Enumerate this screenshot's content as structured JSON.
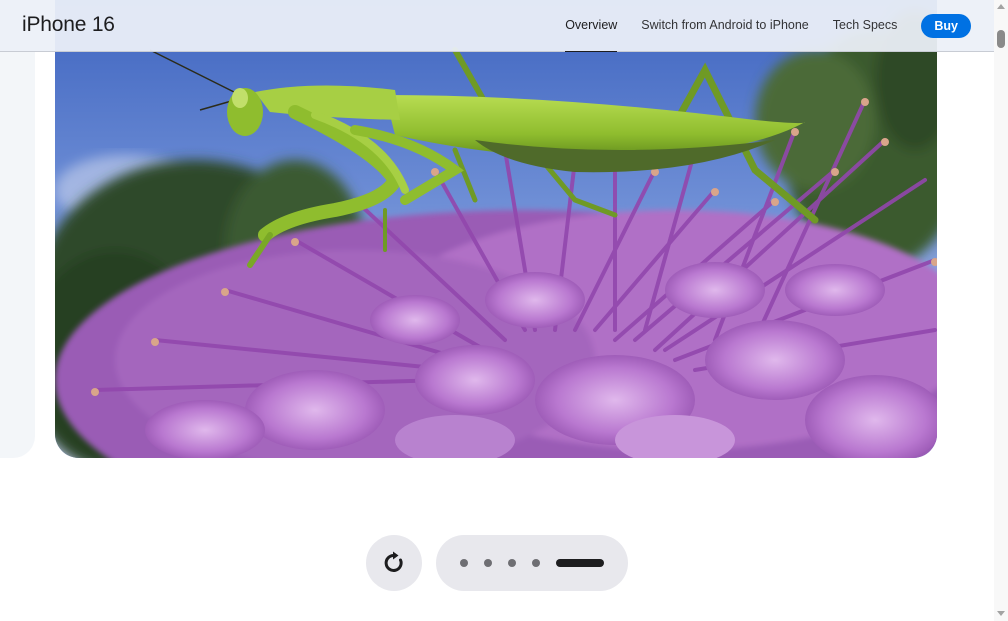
{
  "header": {
    "product_title": "iPhone 16",
    "nav": [
      {
        "label": "Overview",
        "active": true
      },
      {
        "label": "Switch from Android to iPhone",
        "active": false
      },
      {
        "label": "Tech Specs",
        "active": false
      }
    ],
    "buy_label": "Buy"
  },
  "media": {
    "subject": "praying mantis on purple allium flower"
  },
  "controls": {
    "replay_icon": "replay-icon",
    "total_slides": 5,
    "current_slide": 5
  },
  "colors": {
    "accent": "#0071e3",
    "nav_bg": "#ecf0f8",
    "control_bg": "#e8e8ed"
  }
}
